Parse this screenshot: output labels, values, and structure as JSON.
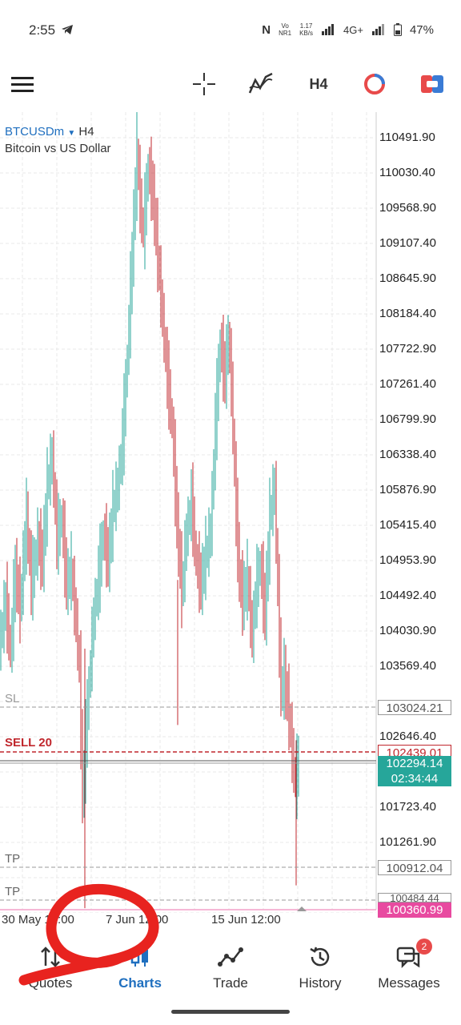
{
  "status_bar": {
    "time": "2:55",
    "network_speed_value": "1.17",
    "network_speed_unit": "KB/s",
    "network_type": "4G+",
    "battery": "47%"
  },
  "toolbar": {
    "timeframe": "H4"
  },
  "chart": {
    "symbol": "BTCUSDm",
    "timeframe": "H4",
    "description": "Bitcoin vs US Dollar",
    "price_levels": [
      "110491.90",
      "110030.40",
      "109568.90",
      "109107.40",
      "108645.90",
      "108184.40",
      "107722.90",
      "107261.40",
      "106799.90",
      "106338.40",
      "105876.90",
      "105415.40",
      "104953.90",
      "104492.40",
      "104030.90",
      "103569.40",
      "102646.40",
      "101723.40",
      "101261.90"
    ],
    "sl": {
      "label": "SL",
      "price": "103024.21",
      "color": "#999999"
    },
    "sell": {
      "label": "SELL 20",
      "price": "102439.01",
      "color": "#c0272d"
    },
    "bid": {
      "price": "102294.14",
      "timer": "02:34:44",
      "color": "#26a69a"
    },
    "tp1": {
      "label": "TP",
      "price": "100912.04"
    },
    "tp2": {
      "label": "TP",
      "price": "100484.44"
    },
    "ask": {
      "price": "100360.99",
      "color": "#e84aa0"
    },
    "x_labels": [
      "30 May 12:00",
      "7 Jun 12:00",
      "15 Jun 12:00"
    ],
    "up_color": "#26a69a",
    "down_color": "#c0272d"
  },
  "bottom_nav": {
    "items": [
      {
        "label": "Quotes",
        "icon": "quotes-icon"
      },
      {
        "label": "Charts",
        "icon": "candles-icon"
      },
      {
        "label": "Trade",
        "icon": "trade-icon"
      },
      {
        "label": "History",
        "icon": "history-icon"
      },
      {
        "label": "Messages",
        "icon": "messages-icon"
      }
    ],
    "messages_badge": "2",
    "active": "Charts"
  }
}
